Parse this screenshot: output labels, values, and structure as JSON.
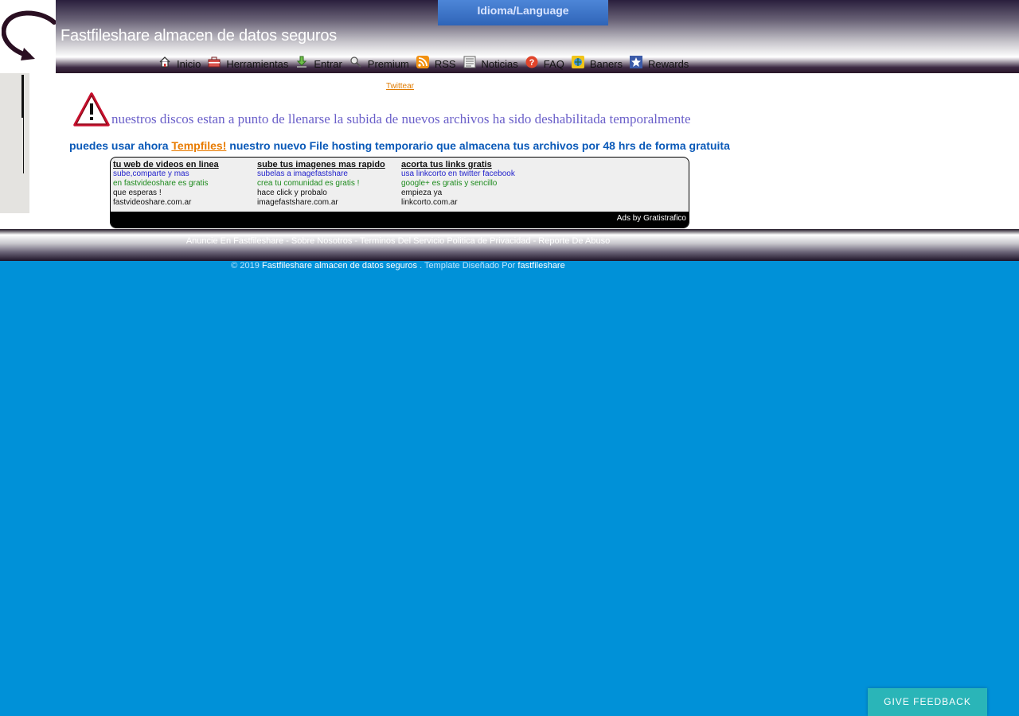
{
  "header": {
    "site_title": "Fastfileshare almacen de datos seguros",
    "language_button": "Idioma/Language"
  },
  "nav": [
    {
      "label": "Inicio",
      "icon": "home-icon"
    },
    {
      "label": "Herramientas",
      "icon": "toolbox-icon"
    },
    {
      "label": "Entrar",
      "icon": "login-arrow-icon"
    },
    {
      "label": "Premium",
      "icon": "search-key-icon"
    },
    {
      "label": "RSS",
      "icon": "rss-icon"
    },
    {
      "label": "Noticias",
      "icon": "news-icon"
    },
    {
      "label": "FAQ",
      "icon": "help-icon"
    },
    {
      "label": "Baners",
      "icon": "globe-icon"
    },
    {
      "label": "Rewards",
      "icon": "star-icon"
    }
  ],
  "main": {
    "twittear": "Twittear",
    "warning": "nuestros discos estan a punto de llenarse la subida de nuevos archivos ha sido deshabilitada temporalmente",
    "promo_before": "puedes usar ahora ",
    "promo_link": "Tempfiles!",
    "promo_after": " nuestro nuevo File hosting temporario que almacena tus archivos por 48 hrs de forma gratuita"
  },
  "ads": {
    "columns": [
      {
        "title": "tu web de videos en linea",
        "line1": "sube,comparte y mas",
        "line2": "en fastvideoshare es gratis",
        "line3": "que esperas !",
        "line4": "fastvideoshare.com.ar"
      },
      {
        "title": "sube tus imagenes mas rapido",
        "line1": "subelas a imagefastshare",
        "line2": "crea tu comunidad es gratis !",
        "line3": "hace click y probalo",
        "line4": "imagefastshare.com.ar"
      },
      {
        "title": "acorta tus links gratis",
        "line1": "usa linkcorto en twitter facebook",
        "line2": "google+ es gratis y sencillo",
        "line3": "empieza ya",
        "line4": "linkcorto.com.ar"
      }
    ],
    "footer": "Ads by Gratistrafico"
  },
  "footer": {
    "links": [
      "Anuncie En Fastfileshare",
      "Sobre Nosotros",
      "Terminos Del Servicio",
      "Politica de Privacidad",
      "Reporte De Abuso"
    ],
    "copyright_prefix": "© 2019 ",
    "copyright_site": "Fastfileshare almacen de datos seguros",
    "copyright_mid": " . Template Diseñado Por ",
    "copyright_author": "fastfileshare"
  },
  "feedback_button": "GIVE FEEDBACK"
}
